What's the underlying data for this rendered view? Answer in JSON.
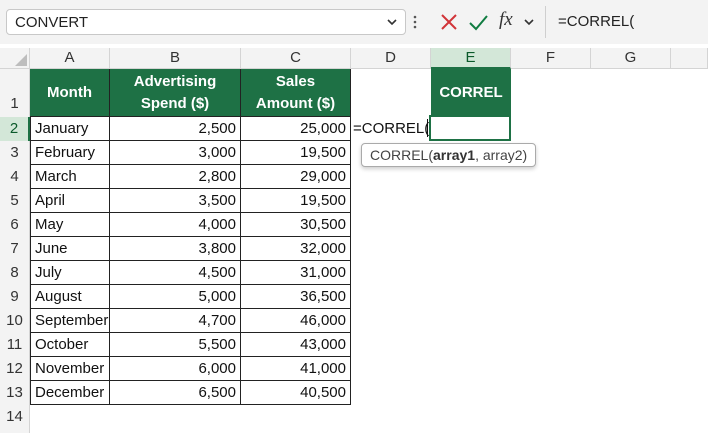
{
  "formula_bar": {
    "name_box": "CONVERT",
    "fx_label": "fx",
    "formula": "=CORREL("
  },
  "columns": [
    "A",
    "B",
    "C",
    "D",
    "E",
    "F",
    "G"
  ],
  "rows": [
    "1",
    "2",
    "3",
    "4",
    "5",
    "6",
    "7",
    "8",
    "9",
    "10",
    "11",
    "12",
    "13",
    "14"
  ],
  "table": {
    "headers": {
      "month": "Month",
      "ad_spend_line1": "Advertising",
      "ad_spend_line2": "Spend ($)",
      "sales_line1": "Sales",
      "sales_line2": "Amount ($)",
      "correl": "CORREL"
    },
    "data": [
      {
        "month": "January",
        "spend": "2,500",
        "sales": "25,000"
      },
      {
        "month": "February",
        "spend": "3,000",
        "sales": "19,500"
      },
      {
        "month": "March",
        "spend": "2,800",
        "sales": "29,000"
      },
      {
        "month": "April",
        "spend": "3,500",
        "sales": "19,500"
      },
      {
        "month": "May",
        "spend": "4,000",
        "sales": "30,500"
      },
      {
        "month": "June",
        "spend": "3,800",
        "sales": "32,000"
      },
      {
        "month": "July",
        "spend": "4,500",
        "sales": "31,000"
      },
      {
        "month": "August",
        "spend": "5,000",
        "sales": "36,500"
      },
      {
        "month": "September",
        "spend": "4,700",
        "sales": "46,000"
      },
      {
        "month": "October",
        "spend": "5,500",
        "sales": "43,000"
      },
      {
        "month": "November",
        "spend": "6,000",
        "sales": "41,000"
      },
      {
        "month": "December",
        "spend": "6,500",
        "sales": "40,500"
      }
    ]
  },
  "editing_cell": {
    "text": "=CORREL("
  },
  "tooltip": {
    "func": "CORREL(",
    "arg1": "array1",
    "rest": ", array2)"
  },
  "colors": {
    "header_green": "#1e7145",
    "cancel_red": "#d13438",
    "confirm_green": "#107c41"
  }
}
